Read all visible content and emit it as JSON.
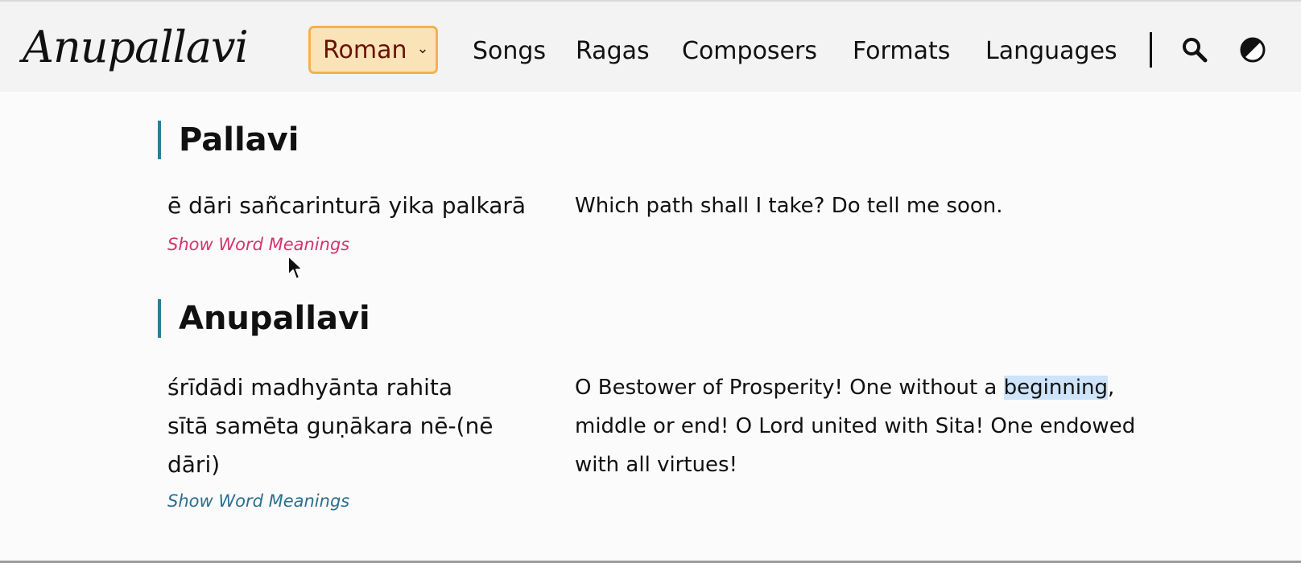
{
  "header": {
    "logo": "Anupallavi",
    "script_select": {
      "value": "Roman"
    },
    "nav": [
      {
        "label": "Songs"
      },
      {
        "label": "Ragas"
      },
      {
        "label": "Composers"
      },
      {
        "label": "Formats"
      },
      {
        "label": "Languages"
      }
    ],
    "icons": {
      "search": "search-icon",
      "theme": "theme-toggle-icon"
    }
  },
  "sections": [
    {
      "title": "Pallavi",
      "lyric_lines": [
        "ē dāri sañcarinturā yika palkarā"
      ],
      "translation": {
        "before": "Which path shall I take? Do tell me soon.",
        "highlight": "",
        "after": ""
      },
      "link": "Show Word Meanings"
    },
    {
      "title": "Anupallavi",
      "lyric_lines": [
        "śrīdādi madhyānta rahita",
        "sītā samēta guṇākara nē-(nē",
        "dāri)"
      ],
      "translation": {
        "before": "O Bestower of Prosperity! One without a ",
        "highlight": "beginning",
        "after": ", middle or end! O Lord united with Sita! One endowed with all virtues!"
      },
      "link": "Show Word Meanings"
    }
  ],
  "colors": {
    "accent_bar": "#2e7d99",
    "link_hover": "#d6336c",
    "link": "#2a6f8f",
    "select_bg": "#fbe3b8",
    "select_border": "#f2b24e",
    "selection_highlight": "#cde4fa"
  }
}
